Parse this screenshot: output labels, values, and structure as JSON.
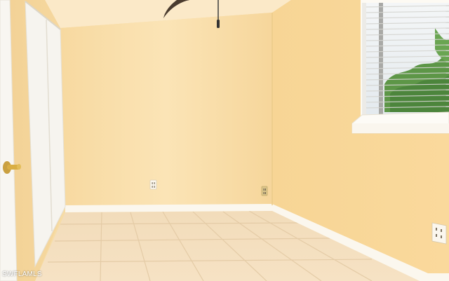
{
  "watermark": {
    "text": "SWFLAMLS"
  },
  "colors": {
    "back_wall": "#f9dfa8",
    "right_wall": "#f8d898",
    "ceiling": "#fbeacb",
    "floor_tile": "#f3dfc0",
    "grout": "#e6cfae",
    "baseboard": "#fbf7ef",
    "door_white": "#f5f3ee",
    "door_knob": "#d8a83a",
    "window_frame": "#fdfaf4",
    "blinds": "#f1f1ee",
    "foliage": "#5f9a4a"
  },
  "icons": {
    "ceiling_fan": "ceiling-fan-icon",
    "door_knob": "door-knob-icon",
    "outlet": "outlet-icon"
  }
}
